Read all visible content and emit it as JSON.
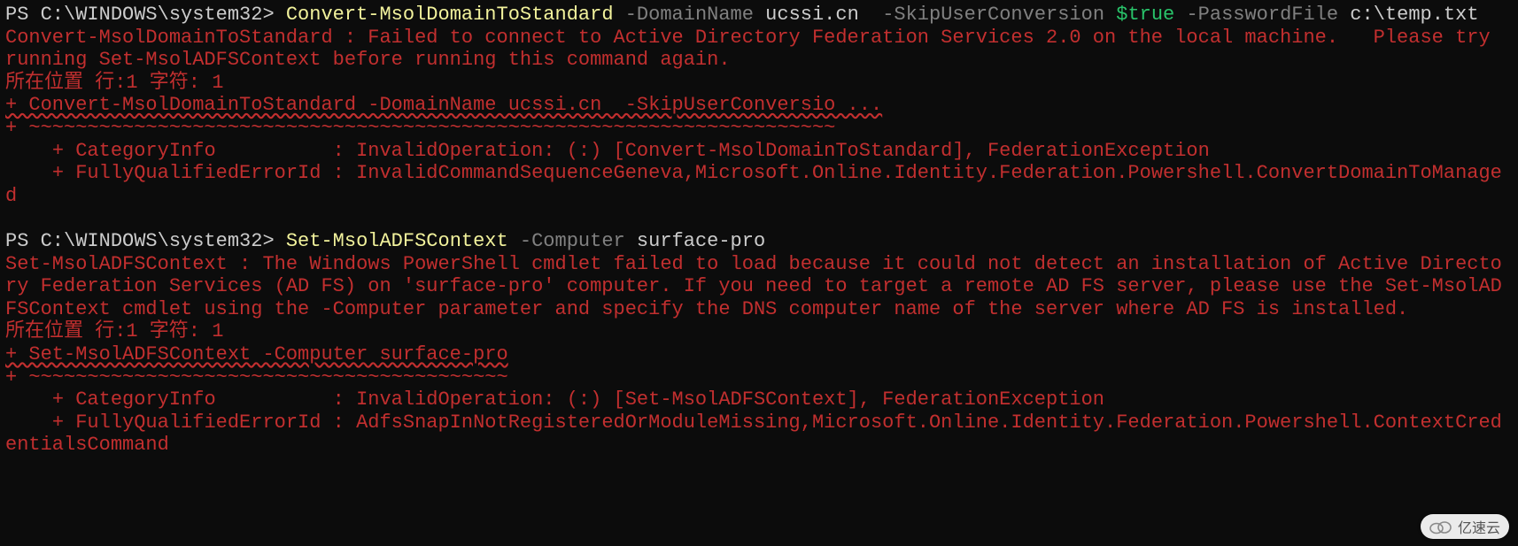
{
  "block1": {
    "prompt": "PS C:\\WINDOWS\\system32> ",
    "cmd": "Convert-MsolDomainToStandard",
    "p1": " -DomainName",
    "a1": " ucssi.cn ",
    "p2": " -SkipUserConversion",
    "a2_bool": " $true",
    "p3": " -PasswordFile",
    "a3": " c:\\temp.txt",
    "err_msg": "Convert-MsolDomainToStandard : Failed to connect to Active Directory Federation Services 2.0 on the local machine.   Please try running Set-MsolADFSContext before running this command again.",
    "err_loc": "所在位置 行:1 字符: 1",
    "err_cmd_line": "+ Convert-MsolDomainToStandard -DomainName ucssi.cn  -SkipUserConversio ...",
    "err_tilde": "+ ~~~~~~~~~~~~~~~~~~~~~~~~~~~~~~~~~~~~~~~~~~~~~~~~~~~~~~~~~~~~~~~~~~~~~",
    "err_cat": "    + CategoryInfo          : InvalidOperation: (:) [Convert-MsolDomainToStandard], FederationException",
    "err_fqid": "    + FullyQualifiedErrorId : InvalidCommandSequenceGeneva,Microsoft.Online.Identity.Federation.Powershell.ConvertDomainToManaged"
  },
  "block2": {
    "prompt": "PS C:\\WINDOWS\\system32> ",
    "cmd": "Set-MsolADFSContext",
    "p1": " -Computer",
    "a1": " surface-pro",
    "err_msg": "Set-MsolADFSContext : The Windows PowerShell cmdlet failed to load because it could not detect an installation of Active Directory Federation Services (AD FS) on 'surface-pro' computer. If you need to target a remote AD FS server, please use the Set-MsolADFSContext cmdlet using the -Computer parameter and specify the DNS computer name of the server where AD FS is installed.",
    "err_loc": "所在位置 行:1 字符: 1",
    "err_cmd_line": "+ Set-MsolADFSContext -Computer surface-pro",
    "err_tilde": "+ ~~~~~~~~~~~~~~~~~~~~~~~~~~~~~~~~~~~~~~~~~",
    "err_cat": "    + CategoryInfo          : InvalidOperation: (:) [Set-MsolADFSContext], FederationException",
    "err_fqid": "    + FullyQualifiedErrorId : AdfsSnapInNotRegisteredOrModuleMissing,Microsoft.Online.Identity.Federation.Powershell.ContextCredentialsCommand"
  },
  "watermark": {
    "text": "亿速云"
  }
}
